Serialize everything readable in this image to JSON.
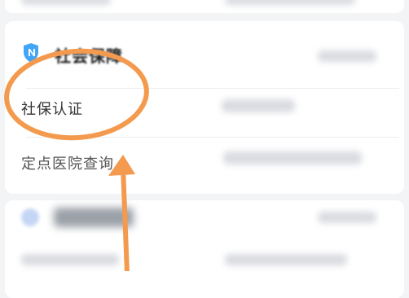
{
  "section": {
    "title": "社会保障",
    "icon": "shield-icon",
    "icon_color": "#40a9ff"
  },
  "items": [
    {
      "label": "社保认证"
    },
    {
      "label": "定点医院查询"
    }
  ],
  "annotation": {
    "highlight_color": "#f39a4f"
  }
}
